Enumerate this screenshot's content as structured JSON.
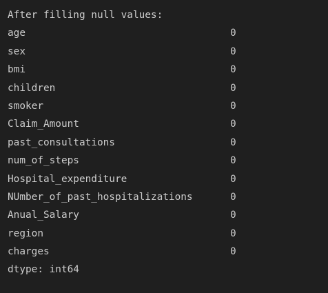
{
  "output": {
    "header": "After filling null values:",
    "rows": [
      {
        "name": "age",
        "value": "0"
      },
      {
        "name": "sex",
        "value": "0"
      },
      {
        "name": "bmi",
        "value": "0"
      },
      {
        "name": "children",
        "value": "0"
      },
      {
        "name": "smoker",
        "value": "0"
      },
      {
        "name": "Claim_Amount",
        "value": "0"
      },
      {
        "name": "past_consultations",
        "value": "0"
      },
      {
        "name": "num_of_steps",
        "value": "0"
      },
      {
        "name": "Hospital_expenditure",
        "value": "0"
      },
      {
        "name": "NUmber_of_past_hospitalizations",
        "value": "0"
      },
      {
        "name": "Anual_Salary",
        "value": "0"
      },
      {
        "name": "region",
        "value": "0"
      },
      {
        "name": "charges",
        "value": "0"
      }
    ],
    "footer": "dtype: int64"
  }
}
